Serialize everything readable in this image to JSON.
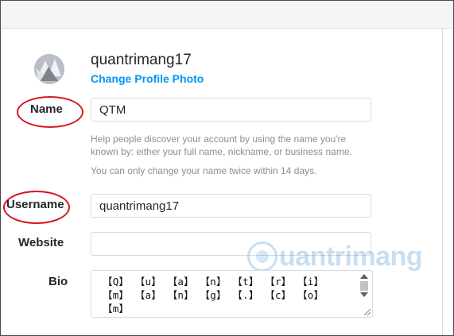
{
  "profile": {
    "username": "quantrimang17",
    "change_photo_label": "Change Profile Photo"
  },
  "form": {
    "name_label": "Name",
    "name_value": "QTM",
    "name_help_1": "Help people discover your account by using the name you're",
    "name_help_2": "known by: either your full name, nickname, or business name.",
    "name_help_3": "You can only change your name twice within 14 days.",
    "username_label": "Username",
    "username_value": "quantrimang17",
    "website_label": "Website",
    "website_value": "",
    "bio_label": "Bio",
    "bio_value": "【Q】 【u】 【a】 【n】 【t】 【r】 【i】\n【m】 【a】 【n】 【g】 【.】 【c】 【o】\n【m】"
  },
  "watermark": {
    "text": "uantrimang"
  },
  "colors": {
    "link": "#0095f6",
    "annotation_ring": "#d8141c"
  }
}
